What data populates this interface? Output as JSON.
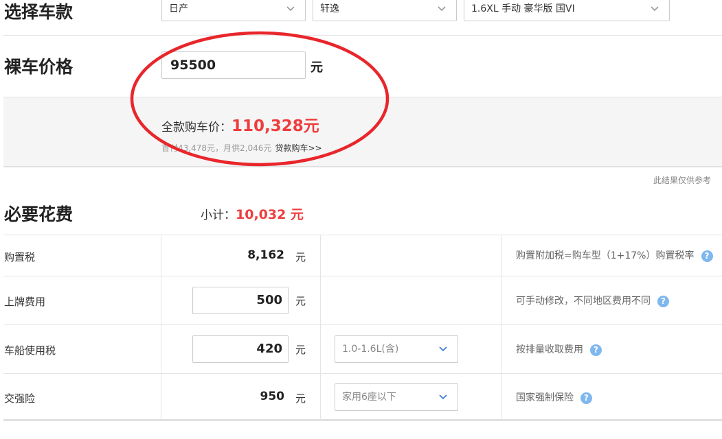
{
  "select_car": {
    "title": "选择车款",
    "brand": "日产",
    "series": "轩逸",
    "model": "1.6XL 手动 豪华版 国VI"
  },
  "bare_price": {
    "title": "裸车价格",
    "value": "95500",
    "unit": "元"
  },
  "summary": {
    "full_price_label": "全款购车价：",
    "full_price_value": "110,328元",
    "loan_info": "首付43,478元，月供2,046元",
    "loan_link": "贷款购车>>",
    "disclaimer": "此结果仅供参考"
  },
  "required": {
    "title": "必要花费",
    "subtotal_label": "小计：",
    "subtotal_value": "10,032 元",
    "rows": [
      {
        "label": "购置税",
        "value": "8,162",
        "unit": "元",
        "note": "购置附加税=购车型（1+17%）购置税率"
      },
      {
        "label": "上牌费用",
        "value": "500",
        "unit": "元",
        "note": "可手动修改，不同地区费用不同"
      },
      {
        "label": "车船使用税",
        "value": "420",
        "unit": "元",
        "select": "1.0-1.6L(含)",
        "note": "按排量收取费用"
      },
      {
        "label": "交强险",
        "value": "950",
        "unit": "元",
        "select": "家用6座以下",
        "note": "国家强制保险"
      }
    ]
  },
  "colors": {
    "accent_red": "#ee3d3d",
    "help_blue": "#7fb7ef",
    "circle_red": "#e8262b"
  },
  "icons": {
    "dropdown": "chevron-down-icon",
    "help": "question-circle-icon"
  }
}
